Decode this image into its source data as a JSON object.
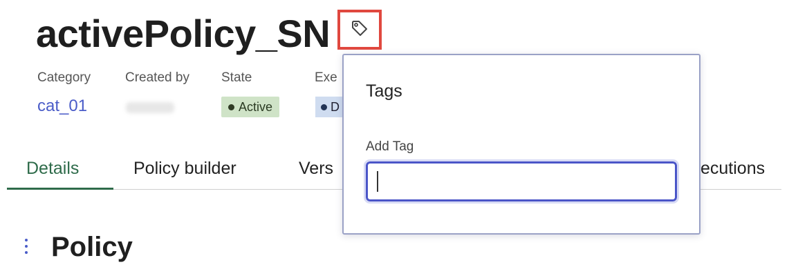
{
  "header": {
    "title": "activePolicy_SN",
    "tag_icon": "tag-icon"
  },
  "meta": {
    "category_label": "Category",
    "category_value": "cat_01",
    "created_by_label": "Created by",
    "state_label": "State",
    "state_value": "Active",
    "exec_label": "Exe",
    "exec_value": "D"
  },
  "tabs": [
    {
      "label": "Details",
      "active": true
    },
    {
      "label": "Policy builder",
      "active": false
    },
    {
      "label": "Vers",
      "active": false
    },
    {
      "label": "ecutions",
      "active": false
    }
  ],
  "section": {
    "title": "Policy",
    "grip_icon": "drag-handle-icon"
  },
  "tags_popover": {
    "title": "Tags",
    "field_label": "Add Tag",
    "field_value": "",
    "placeholder": ""
  },
  "colors": {
    "accent": "#4a5cc8",
    "active_tab": "#2e6b4a",
    "highlight_border": "#e0483f",
    "active_badge_bg": "#cfe3c7",
    "blue_badge_bg": "#cfdcf0"
  }
}
